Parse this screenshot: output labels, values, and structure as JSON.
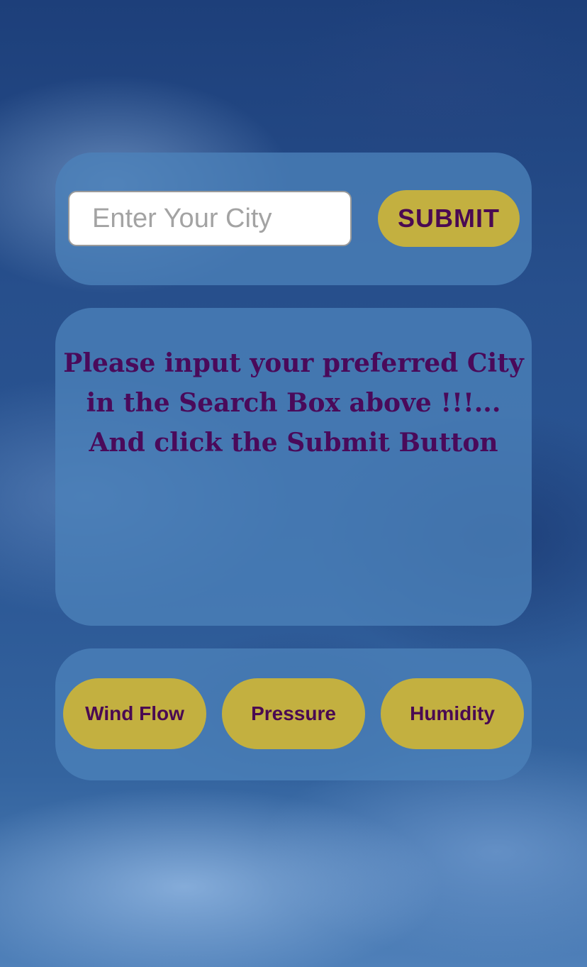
{
  "search": {
    "placeholder": "Enter Your City",
    "value": "",
    "submit_label": "SUBMIT"
  },
  "message": {
    "text": "Please input your preferred City in the Search Box above !!!... And click the Submit Button"
  },
  "stats": {
    "buttons": [
      {
        "label": "Wind Flow"
      },
      {
        "label": "Pressure"
      },
      {
        "label": "Humidity"
      }
    ]
  },
  "colors": {
    "accent_button": "#c3b040",
    "button_text": "#4a0a52",
    "panel": "#4c82ba",
    "message_text": "#4a0a5a"
  }
}
